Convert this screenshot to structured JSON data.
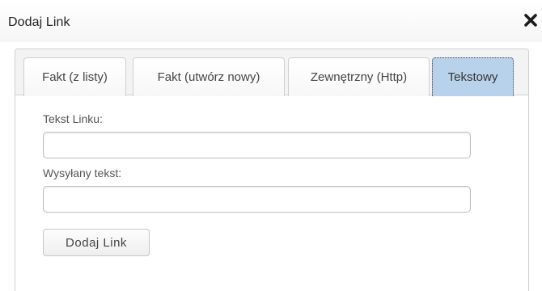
{
  "dialog": {
    "title": "Dodaj Link",
    "close_icon": "close-icon"
  },
  "tabs": [
    {
      "label": "Fakt (z listy)",
      "active": false
    },
    {
      "label": "Fakt (utwórz nowy)",
      "active": false
    },
    {
      "label": "Zewnętrzny (Http)",
      "active": false
    },
    {
      "label": "Tekstowy",
      "active": true
    }
  ],
  "form": {
    "link_text_label": "Tekst Linku:",
    "link_text_value": "",
    "sent_text_label": "Wysyłany tekst:",
    "sent_text_value": "",
    "submit_label": "Dodaj Link"
  },
  "colors": {
    "active_tab": "#b9d2ec",
    "tabstrip": "#f3f3f3"
  }
}
